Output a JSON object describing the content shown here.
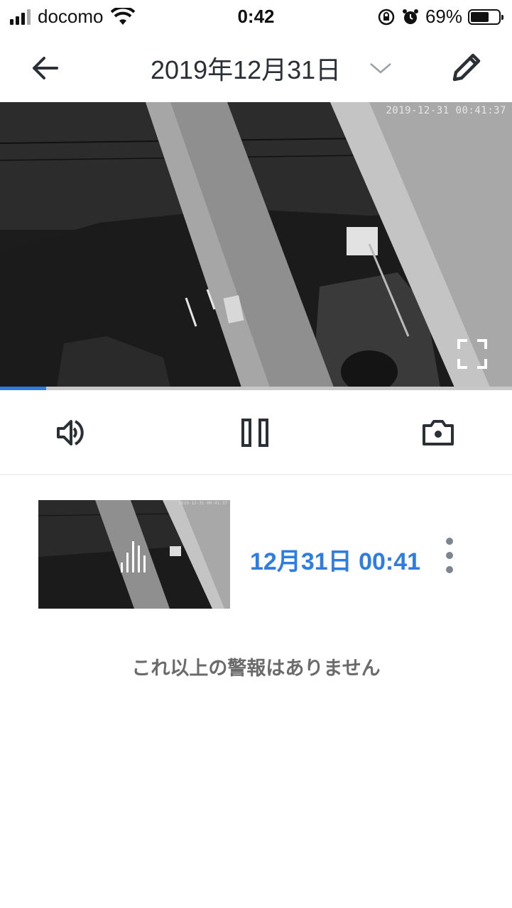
{
  "status_bar": {
    "carrier": "docomo",
    "time": "0:42",
    "battery": "69%",
    "battery_level": 0.69
  },
  "nav": {
    "title": "2019年12月31日",
    "back_icon": "arrow-left-icon",
    "dropdown_icon": "chevron-down-icon",
    "edit_icon": "pencil-icon"
  },
  "video": {
    "timestamp": "2019-12-31 00:41:37",
    "progress": 0.09
  },
  "controls": {
    "volume_icon": "speaker-icon",
    "pause_icon": "pause-icon",
    "snapshot_icon": "camera-icon"
  },
  "event": {
    "time": "12月31日 00:41",
    "thumb_timestamp": "2019-12-31 00:41:37"
  },
  "footer": {
    "message": "これ以上の警報はありません"
  },
  "colors": {
    "accent": "#2e7de0",
    "text": "#2b2f36"
  }
}
